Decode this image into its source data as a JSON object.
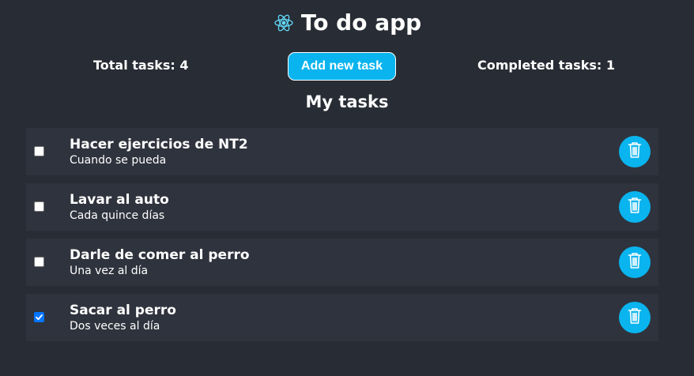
{
  "app": {
    "title": "To do app",
    "logo_icon": "react-atom-icon",
    "accent_color": "#0ab4ee"
  },
  "stats": {
    "total_label": "Total tasks: 4",
    "completed_label": "Completed tasks: 1",
    "add_button_label": "Add new task"
  },
  "section": {
    "title": "My tasks"
  },
  "tasks": [
    {
      "title": "Hacer ejercicios de NT2",
      "description": "Cuando se pueda",
      "completed": false,
      "delete_icon": "trash-icon"
    },
    {
      "title": "Lavar al auto",
      "description": "Cada quince días",
      "completed": false,
      "delete_icon": "trash-icon"
    },
    {
      "title": "Darle de comer al perro",
      "description": "Una vez al día",
      "completed": false,
      "delete_icon": "trash-icon"
    },
    {
      "title": "Sacar al perro",
      "description": "Dos veces al día",
      "completed": true,
      "delete_icon": "trash-icon"
    }
  ]
}
